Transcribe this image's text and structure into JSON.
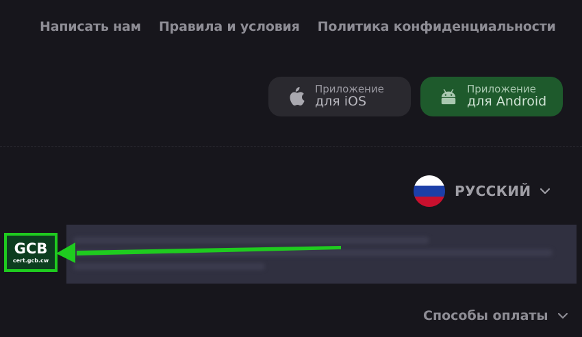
{
  "footer_links": [
    {
      "label": "Написать нам"
    },
    {
      "label": "Правила и условия"
    },
    {
      "label": "Политика конфиденциальности"
    }
  ],
  "apps": {
    "ios": {
      "line1": "Приложение",
      "line2": "для iOS"
    },
    "android": {
      "line1": "Приложение",
      "line2": "для Android"
    }
  },
  "language": {
    "label": "РУССКИЙ",
    "flag_colors": [
      "#ffffff",
      "#1c3fa8",
      "#c8102e"
    ]
  },
  "badge": {
    "title": "GCB",
    "subtitle": "cert.gcb.cw",
    "accent": "#1fcb1f"
  },
  "payment": {
    "label": "Способы оплаты"
  },
  "icons": {
    "ios": "apple-icon",
    "android": "android-icon",
    "chevron": "chevron-down-icon"
  }
}
